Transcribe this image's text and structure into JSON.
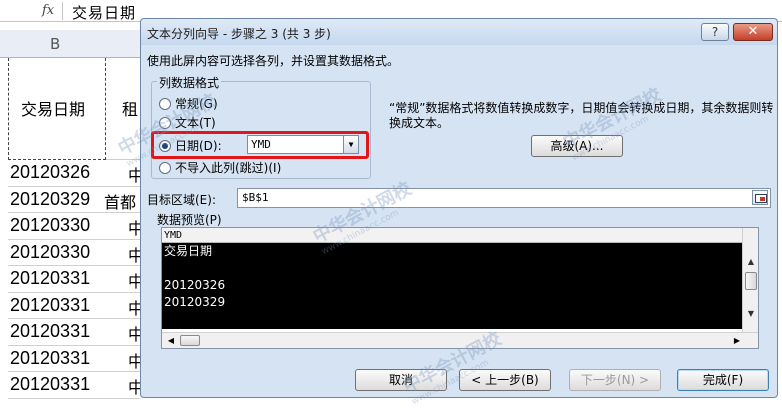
{
  "spreadsheet": {
    "formula_icon": "fx",
    "formula_value": "交易日期",
    "column_header": "B",
    "header_cell": "交易日期",
    "side_header": "租",
    "rows": [
      {
        "date": "20120326",
        "name": "中"
      },
      {
        "date": "20120329",
        "name": "首都"
      },
      {
        "date": "20120330",
        "name": "中"
      },
      {
        "date": "20120330",
        "name": "中"
      },
      {
        "date": "20120331",
        "name": "中"
      },
      {
        "date": "20120331",
        "name": "中"
      },
      {
        "date": "20120331",
        "name": "中"
      },
      {
        "date": "20120331",
        "name": "中"
      },
      {
        "date": "20120331",
        "name": "中"
      }
    ]
  },
  "dialog": {
    "title": "文本分列向导 - 步骤之 3 (共 3 步)",
    "help_label": "?",
    "close_label": "✕",
    "description": "使用此屏内容可选择各列，并设置其数据格式。",
    "column_format": {
      "group_title": "列数据格式",
      "options": [
        {
          "label": "常规(G)",
          "selected": false
        },
        {
          "label": "文本(T)",
          "selected": false
        },
        {
          "label": "日期(D):",
          "selected": true
        },
        {
          "label": "不导入此列(跳过)(I)",
          "selected": false
        }
      ],
      "date_format_value": "YMD",
      "highlight_color": "#e0161b"
    },
    "info_text": "“常规”数据格式将数值转换成数字，日期值会转换成日期，其余数据则转换成文本。",
    "advanced_button": "高级(A)...",
    "target_label": "目标区域(E):",
    "target_value": "$B$1",
    "preview_label": "数据预览(P)",
    "preview": {
      "column_header": "YMD",
      "lines": [
        "交易日期",
        "",
        "20120326",
        "20120329"
      ]
    },
    "buttons": {
      "cancel": "取消",
      "back": "< 上一步(B)",
      "next": "下一步(N) >",
      "finish": "完成(F)"
    }
  },
  "watermarks": [
    {
      "text": "中华会计网校",
      "sub": "www.chinaacc.com"
    },
    {
      "text": "中华会计网校",
      "sub": "www.chinaacc.com"
    },
    {
      "text": "中华会计网校",
      "sub": "www.chinaacc.com"
    },
    {
      "text": "中华会计网校",
      "sub": "www.chinaacc.com"
    }
  ],
  "colors": {
    "dialog_bg": "#d6e3f3",
    "highlight": "#e0161b",
    "preview_bg": "#000000"
  }
}
